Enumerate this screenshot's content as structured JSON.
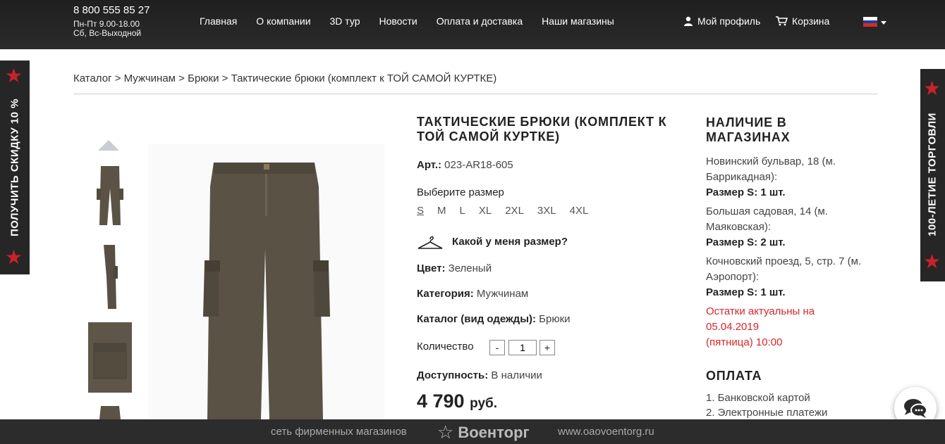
{
  "header": {
    "phone": "8 800 555 85 27",
    "hours_weekdays": "Пн-Пт 9.00-18.00",
    "hours_weekend": "Сб, Вс-Выходной",
    "nav": [
      "Главная",
      "О компании",
      "3D тур",
      "Новости",
      "Оплата и доставка",
      "Наши магазины"
    ],
    "profile": "Мой профиль",
    "cart": "Корзина",
    "language_flag": "ru-flag-icon"
  },
  "side_banners": {
    "left": "ПОЛУЧИТЬ СКИДКУ 10 %",
    "right": "100-ЛЕТИЕ ТОРГОВЛИ"
  },
  "breadcrumb": {
    "items": [
      "Каталог",
      "Мужчинам",
      "Брюки"
    ],
    "current": "Тактические брюки (комплект к ТОЙ САМОЙ КУРТКЕ)",
    "separator": ">"
  },
  "product": {
    "title": "ТАКТИЧЕСКИЕ БРЮКИ (КОМПЛЕКТ К ТОЙ САМОЙ КУРТКЕ)",
    "article_label": "Арт.:",
    "article": "023-AR18-605",
    "size_label": "Выберите размер",
    "sizes": [
      "S",
      "M",
      "L",
      "XL",
      "2XL",
      "3XL",
      "4XL"
    ],
    "selected_size": "S",
    "size_help": "Какой у меня размер?",
    "color_label": "Цвет:",
    "color": "Зеленый",
    "category_label": "Категория:",
    "category": "Мужчинам",
    "catalog_label": "Каталог (вид одежды):",
    "catalog": "Брюки",
    "quantity_label": "Количество",
    "quantity_minus": "-",
    "quantity": "1",
    "quantity_plus": "+",
    "availability_label": "Доступность:",
    "availability": "В наличии",
    "price": "4 790",
    "currency": "руб."
  },
  "stores": {
    "heading": "НАЛИЧИЕ В МАГАЗИНАХ",
    "list": [
      {
        "address": "Новинский бульвар, 18 (м. Баррикадная):",
        "stock": "Размер S: 1 шт."
      },
      {
        "address": "Большая садовая, 14 (м. Маяковская):",
        "stock": "Размер S: 2 шт."
      },
      {
        "address": "Кочновский проезд, 5, стр. 7 (м. Аэропорт):",
        "stock": "Размер S: 1 шт."
      }
    ],
    "note_line1": "Остатки актуальны на",
    "note_line2": "05.04.2019",
    "note_line3": "(пятница) 10:00"
  },
  "payment": {
    "heading": "ОПЛАТА",
    "items": [
      "1. Банковской картой",
      "2. Электронные платежи"
    ]
  },
  "footer": {
    "left": "сеть фирменных магазинов",
    "brand": "Военторг",
    "url": "www.oaovoentorg.ru"
  },
  "colors": {
    "header_bg": "#222222",
    "accent_red": "#d7262c",
    "footer_bg": "#2c2c2c"
  }
}
